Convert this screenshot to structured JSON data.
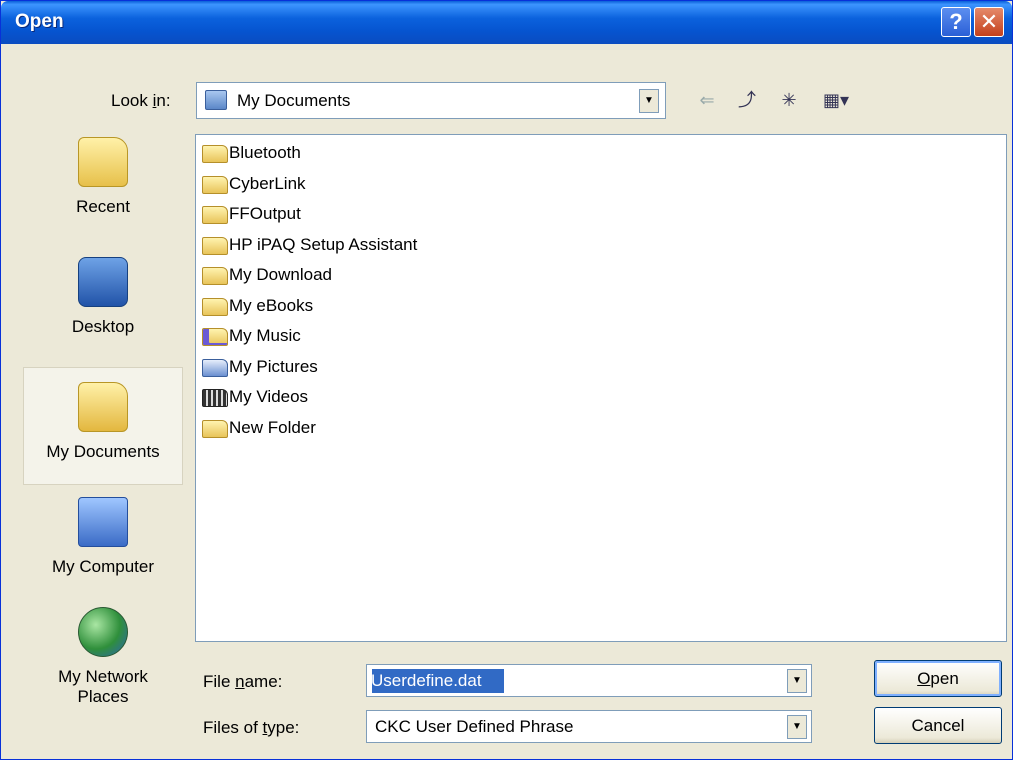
{
  "window": {
    "title": "Open",
    "help_glyph": "?",
    "close_glyph": "✕"
  },
  "toolbar": {
    "look_in_label_pre": "Look ",
    "look_in_label_key": "i",
    "look_in_label_post": "n:",
    "look_in_value": "My Documents",
    "back_icon": "back-arrow-icon",
    "up_icon": "up-one-level-icon",
    "new_folder_icon": "new-folder-icon",
    "views_icon": "views-menu-icon"
  },
  "places": [
    {
      "label": "Recent",
      "icon": "recent-folder-icon"
    },
    {
      "label": "Desktop",
      "icon": "desktop-icon"
    },
    {
      "label": "My Documents",
      "icon": "my-documents-icon",
      "selected": true
    },
    {
      "label": "My Computer",
      "icon": "my-computer-icon"
    },
    {
      "label": "My Network Places",
      "icon": "network-places-icon"
    }
  ],
  "files": [
    {
      "name": "Bluetooth",
      "icon": "folder-icon"
    },
    {
      "name": "CyberLink",
      "icon": "folder-icon"
    },
    {
      "name": "FFOutput",
      "icon": "folder-icon"
    },
    {
      "name": "HP iPAQ Setup Assistant",
      "icon": "folder-icon"
    },
    {
      "name": "My Download",
      "icon": "folder-icon"
    },
    {
      "name": "My eBooks",
      "icon": "folder-icon"
    },
    {
      "name": "My Music",
      "icon": "music-folder-icon"
    },
    {
      "name": "My Pictures",
      "icon": "pictures-folder-icon"
    },
    {
      "name": "My Videos",
      "icon": "videos-folder-icon"
    },
    {
      "name": "New Folder",
      "icon": "folder-icon"
    }
  ],
  "form": {
    "file_name_label_pre": "File ",
    "file_name_label_key": "n",
    "file_name_label_post": "ame:",
    "file_name_value": "Userdefine.dat",
    "file_type_label_pre": "Files of ",
    "file_type_label_key": "t",
    "file_type_label_post": "ype:",
    "file_type_value": "CKC User Defined Phrase"
  },
  "buttons": {
    "open_key": "O",
    "open_rest": "pen",
    "cancel": "Cancel"
  },
  "colors": {
    "title_bar": "#0a5fd8",
    "selection": "#316ac5",
    "dialog_bg": "#ece9d8"
  }
}
